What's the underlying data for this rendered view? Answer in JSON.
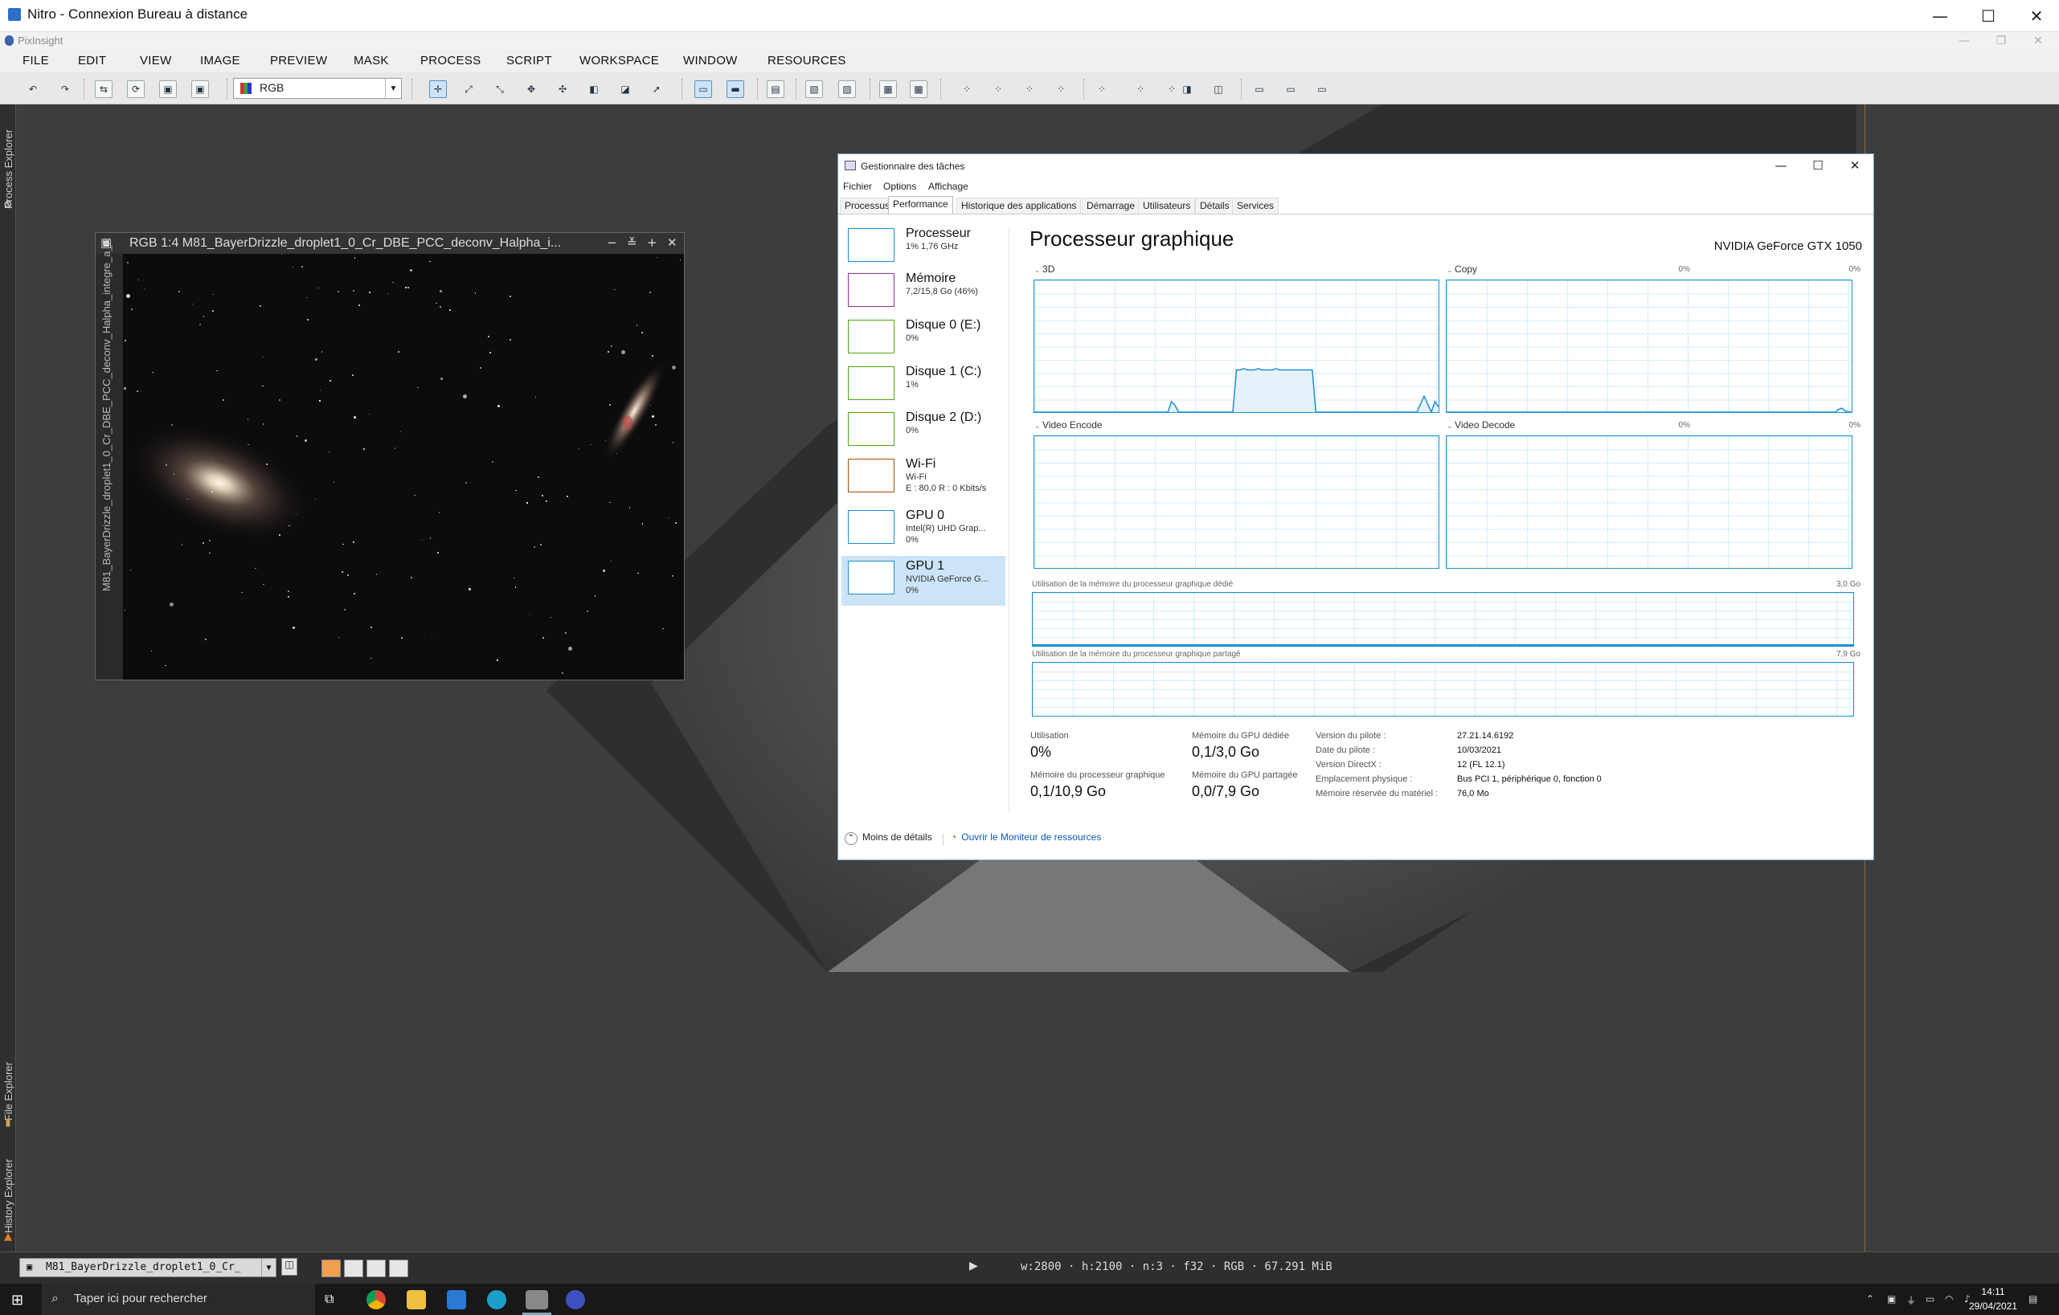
{
  "rdp": {
    "title": "Nitro - Connexion Bureau à distance",
    "minimize": "—",
    "maximize": "☐",
    "close": "✕"
  },
  "pixinsight": {
    "title": "PixInsight"
  },
  "menu": [
    "FILE",
    "EDIT",
    "VIEW",
    "IMAGE",
    "PREVIEW",
    "MASK",
    "PROCESS",
    "SCRIPT",
    "WORKSPACE",
    "WINDOW",
    "RESOURCES"
  ],
  "toolbar": {
    "color_mode": "RGB"
  },
  "side_tabs": {
    "process_explorer": "Process Explorer",
    "file_explorer": "File Explorer",
    "history_explorer": "History Explorer"
  },
  "image_window": {
    "title": "RGB 1:4 M81_BayerDrizzle_droplet1_0_Cr_DBE_PCC_deconv_Halpha_i...",
    "side_label": "M81_BayerDrizzle_droplet1_0_Cr_DBE_PCC_deconv_Halpha_integre_a_R"
  },
  "task_manager": {
    "title": "Gestionnaire des tâches",
    "menu": [
      "Fichier",
      "Options",
      "Affichage"
    ],
    "tabs": [
      "Processus",
      "Performance",
      "Historique des applications",
      "Démarrage",
      "Utilisateurs",
      "Détails",
      "Services"
    ],
    "active_tab": "Performance",
    "sidebar": [
      {
        "name": "Processeur",
        "line1": "1% 1,76 GHz",
        "line2": "",
        "color": "#1c8fd6"
      },
      {
        "name": "Mémoire",
        "line1": "7,2/15,8 Go (46%)",
        "line2": "",
        "color": "#9a2aa0"
      },
      {
        "name": "Disque 0 (E:)",
        "line1": "0%",
        "line2": "",
        "color": "#4da60c"
      },
      {
        "name": "Disque 1 (C:)",
        "line1": "1%",
        "line2": "",
        "color": "#4da60c"
      },
      {
        "name": "Disque 2 (D:)",
        "line1": "0%",
        "line2": "",
        "color": "#4da60c"
      },
      {
        "name": "Wi-Fi",
        "line1": "Wi-Fi",
        "line2": "E : 80,0 R : 0 Kbits/s",
        "color": "#a74f01"
      },
      {
        "name": "GPU 0",
        "line1": "Intel(R) UHD Grap...",
        "line2": "0%",
        "color": "#1c8fd6"
      },
      {
        "name": "GPU 1",
        "line1": "NVIDIA GeForce G...",
        "line2": "0%",
        "color": "#1c8fd6"
      }
    ],
    "heading": "Processeur graphique",
    "gpu_name": "NVIDIA GeForce GTX 1050",
    "engines": [
      {
        "label": "3D",
        "pct": "0%"
      },
      {
        "label": "Copy",
        "pct": "0%"
      },
      {
        "label": "Video Encode",
        "pct": "0%"
      },
      {
        "label": "Video Decode",
        "pct": "0%"
      }
    ],
    "dedicated_label": "Utilisation de la mémoire du processeur graphique dédié",
    "dedicated_max": "3,0 Go",
    "shared_label": "Utilisation de la mémoire du processeur graphique partagé",
    "shared_max": "7,9 Go",
    "stats": {
      "utilisation_label": "Utilisation",
      "utilisation": "0%",
      "gpu_mem_label": "Mémoire du processeur graphique",
      "gpu_mem": "0,1/10,9 Go",
      "dedicated_mem_label": "Mémoire du GPU dédiée",
      "dedicated_mem": "0,1/3,0 Go",
      "shared_mem_label": "Mémoire du GPU partagée",
      "shared_mem": "0,0/7,9 Go"
    },
    "driver": [
      {
        "k": "Version du pilote :",
        "v": "27.21.14.6192"
      },
      {
        "k": "Date du pilote :",
        "v": "10/03/2021"
      },
      {
        "k": "Version DirectX :",
        "v": "12 (FL 12.1)"
      },
      {
        "k": "Emplacement physique :",
        "v": "Bus PCI 1, périphérique 0, fonction 0"
      },
      {
        "k": "Mémoire réservée du matériel :",
        "v": "76,0 Mo"
      }
    ],
    "less_details": "Moins de détails",
    "resource_monitor": "Ouvrir le Moniteur de ressources",
    "graph_3d_util": [
      0,
      0,
      0,
      0,
      0,
      0,
      0,
      0,
      0,
      0,
      0,
      0,
      0,
      0,
      0,
      0,
      0,
      0,
      0,
      0,
      0,
      0,
      0,
      0,
      0,
      0,
      0,
      0,
      0,
      0,
      0,
      0,
      0,
      0,
      0,
      0,
      0,
      0,
      8,
      5,
      0,
      0,
      0,
      0,
      0,
      0,
      0,
      0,
      0,
      0,
      0,
      0,
      0,
      0,
      0,
      0,
      32,
      32,
      33,
      32,
      32,
      32,
      33,
      32,
      32,
      32,
      32,
      33,
      32,
      32,
      32,
      32,
      32,
      32,
      32,
      32,
      32,
      32,
      0,
      0,
      0,
      0,
      0,
      0,
      0,
      0,
      0,
      0,
      0,
      0,
      0,
      0,
      0,
      0,
      0,
      0,
      0,
      0,
      0,
      0,
      0,
      0,
      0,
      0,
      0,
      0,
      0,
      6,
      12,
      6,
      0,
      8,
      4
    ],
    "graph_copy_util": [
      0,
      0,
      0,
      0,
      0,
      0,
      0,
      0,
      0,
      0,
      0,
      0,
      0,
      0,
      0,
      0,
      0,
      0,
      0,
      0,
      0,
      0,
      0,
      0,
      0,
      0,
      0,
      0,
      0,
      0,
      0,
      0,
      0,
      0,
      0,
      0,
      0,
      0,
      0,
      0,
      0,
      0,
      0,
      0,
      0,
      0,
      0,
      0,
      0,
      0,
      0,
      0,
      0,
      0,
      0,
      0,
      0,
      0,
      0,
      0,
      0,
      0,
      0,
      0,
      0,
      0,
      0,
      0,
      0,
      0,
      0,
      0,
      0,
      0,
      0,
      0,
      0,
      0,
      0,
      0,
      0,
      0,
      0,
      0,
      0,
      0,
      0,
      0,
      0,
      0,
      0,
      0,
      0,
      0,
      0,
      0,
      0,
      0,
      0,
      0,
      0,
      0,
      0,
      0,
      0,
      0,
      0,
      0,
      0,
      0,
      0,
      0,
      0,
      0,
      0,
      0,
      0,
      0,
      0,
      0,
      2,
      3,
      1,
      0,
      0
    ]
  },
  "statusbar": {
    "view": "M81_BayerDrizzle_droplet1_0_Cr_",
    "info": "w:2800 · h:2100 · n:3 · f32 · RGB · 67.291 MiB"
  },
  "taskbar": {
    "search": "Taper ici pour rechercher",
    "time": "14:11",
    "date": "29/04/2021"
  }
}
